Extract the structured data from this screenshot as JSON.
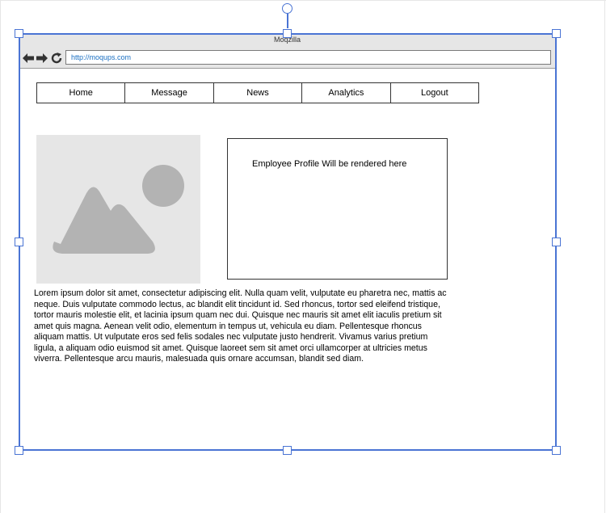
{
  "browser": {
    "title": "Moqzilla",
    "url": "http://moqups.com",
    "nav_icons": [
      "arrow-left-icon",
      "arrow-right-icon",
      "refresh-icon"
    ]
  },
  "navbar": {
    "items": [
      {
        "label": "Home"
      },
      {
        "label": "Message"
      },
      {
        "label": "News"
      },
      {
        "label": "Analytics"
      },
      {
        "label": "Logout"
      }
    ]
  },
  "image_placeholder": {
    "icon": "image-placeholder-icon"
  },
  "profile": {
    "text": "Employee Profile Will be rendered here"
  },
  "body_text": "Lorem ipsum dolor sit amet, consectetur adipiscing elit. Nulla quam velit, vulputate eu pharetra nec, mattis ac neque. Duis vulputate commodo lectus, ac blandit elit tincidunt id. Sed rhoncus, tortor sed eleifend tristique, tortor mauris molestie elit, et lacinia ipsum quam nec dui. Quisque nec mauris sit amet elit iaculis pretium sit amet quis magna. Aenean velit odio, elementum in tempus ut, vehicula eu diam. Pellentesque rhoncus aliquam mattis. Ut vulputate eros sed felis sodales nec vulputate justo hendrerit. Vivamus varius pretium ligula, a aliquam odio euismod sit amet. Quisque laoreet sem sit amet orci ullamcorper at ultricies metus viverra. Pellentesque arcu mauris, malesuada quis ornare accumsan, blandit sed diam.",
  "colors": {
    "selection": "#4a74d4",
    "link": "#1a6fc2",
    "placeholder_bg": "#e6e6e6",
    "placeholder_fg": "#b3b3b3"
  }
}
